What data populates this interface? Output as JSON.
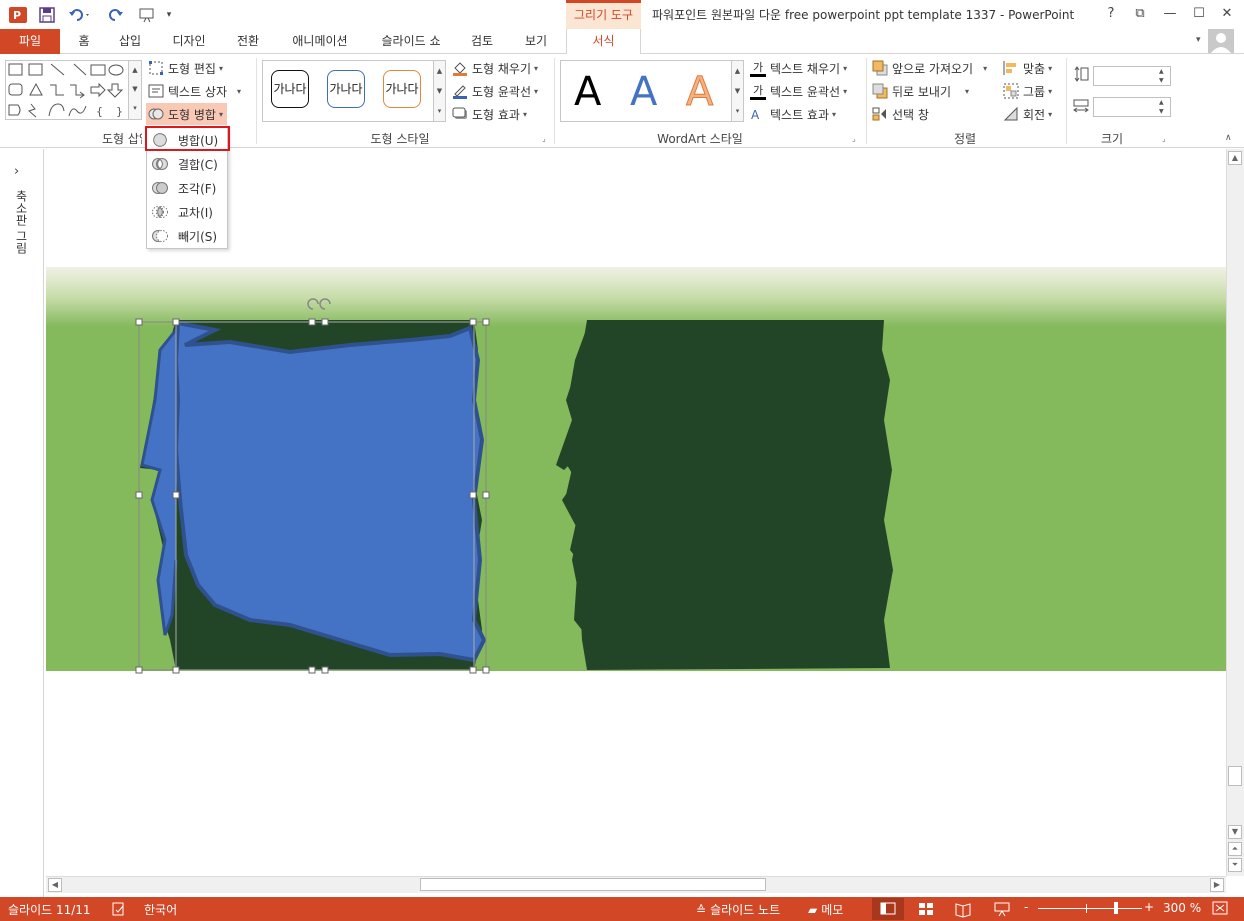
{
  "title_bar": {
    "contextual_tab": "그리기 도구",
    "window_title": "파워포인트 원본파일 다운 free powerpoint ppt template 1337 - PowerPoint",
    "help": "?",
    "restore_ribbon": "⧉",
    "minimize": "—",
    "maximize": "☐",
    "close": "✕"
  },
  "tabs": [
    "파일",
    "홈",
    "삽입",
    "디자인",
    "전환",
    "애니메이션",
    "슬라이드 쇼",
    "검토",
    "보기",
    "서식"
  ],
  "ribbon": {
    "insert_shapes": {
      "label": "도형 삽입",
      "edit_shape": "도형 편집",
      "text_box": "텍스트 상자",
      "merge_shapes": "도형 병합"
    },
    "shape_styles": {
      "label": "도형 스타일",
      "presets": [
        "가나다",
        "가나다",
        "가나다"
      ],
      "fill": "도형 채우기",
      "outline": "도형 윤곽선",
      "effects": "도형 효과"
    },
    "wordart": {
      "label": "WordArt 스타일",
      "glyph": "A",
      "text_fill": "텍스트 채우기",
      "text_outline": "텍스트 윤곽선",
      "text_effects": "텍스트 효과",
      "text_fill_icon_glyph": "가",
      "text_outline_icon_glyph": "가"
    },
    "arrange": {
      "label": "정렬",
      "bring_forward": "앞으로 가져오기",
      "send_backward": "뒤로 보내기",
      "selection_pane": "선택 창",
      "align": "맞춤",
      "group": "그룹",
      "rotate": "회전"
    },
    "size": {
      "label": "크기",
      "height": "",
      "width": ""
    }
  },
  "merge_menu": {
    "items": [
      "병합(U)",
      "결합(C)",
      "조각(F)",
      "교차(I)",
      "빼기(S)"
    ]
  },
  "thumbnail_pane": {
    "label": "축소판 그림",
    "toggle": "›"
  },
  "status_bar": {
    "slide_info": "슬라이드 11/11",
    "language": "한국어",
    "notes": "슬라이드 노트",
    "comments": "메모",
    "zoom": "300 %",
    "zoom_minus": "-",
    "zoom_plus": "+"
  },
  "colors": {
    "accent": "#d24726",
    "slide_green": "#84b95c",
    "dark_green": "#234527",
    "shape_blue": "#4472c4",
    "shape_outline": "#2f528f",
    "highlight_red": "#e0161c"
  }
}
